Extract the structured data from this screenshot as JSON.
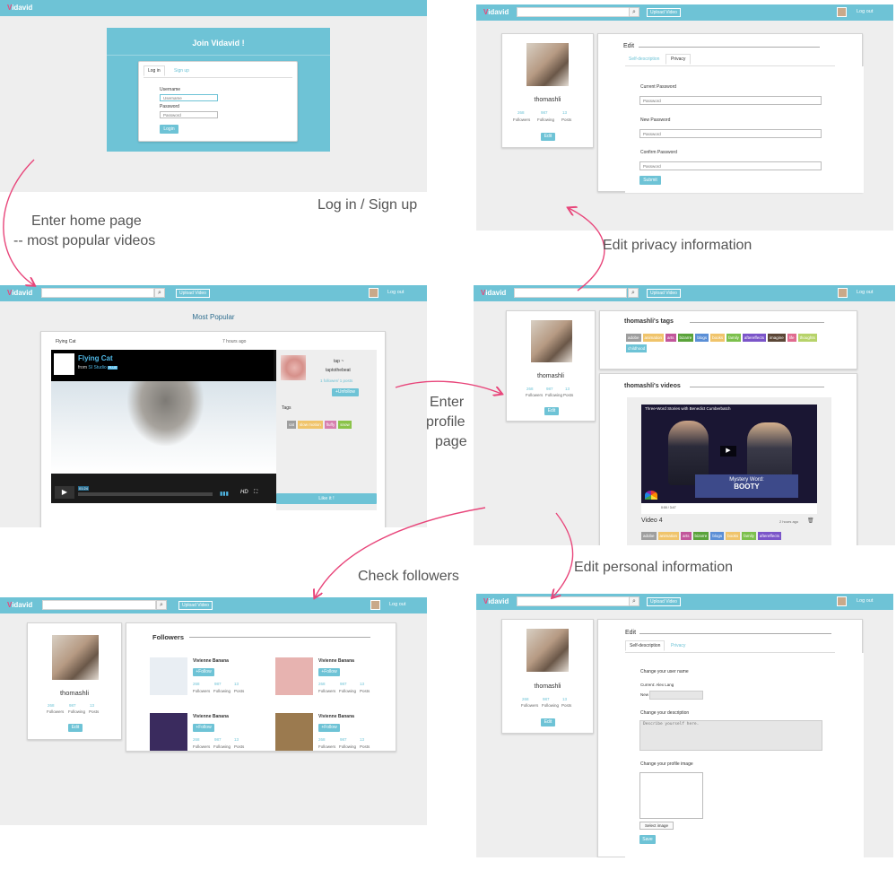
{
  "app": {
    "logo_v": "V",
    "logo_rest": "idavid",
    "upload": "Upload Video",
    "logout": "Log out",
    "search_icon": "search-icon"
  },
  "captions": {
    "login": "Log in / Sign up",
    "home_line1": "Enter home page",
    "home_line2": "-- most popular videos",
    "privacy": "Edit privacy information",
    "profile_line1": "Enter",
    "profile_line2": "profile",
    "profile_line3": "page",
    "followers": "Check followers",
    "personal": "Edit personal information"
  },
  "login": {
    "title": "Join Vidavid !",
    "tab_login": "Log in",
    "tab_signup": "Sign up",
    "username_label": "Username",
    "username_placeholder": "Username",
    "password_label": "Password",
    "password_placeholder": "Password",
    "login_button": "Login"
  },
  "profile": {
    "name": "thomashli",
    "followers_count": "268",
    "following_count": "987",
    "posts_count": "13",
    "followers_label": "Followers",
    "following_label": "Following",
    "posts_label": "Posts",
    "edit_button": "Edit"
  },
  "privacy": {
    "edit_title": "Edit",
    "tab_self": "Self-description",
    "tab_privacy": "Privacy",
    "current_label": "Current Password",
    "new_label": "New Password",
    "confirm_label": "Confirm Password",
    "placeholder": "Password",
    "submit": "Submit"
  },
  "home": {
    "section_title": "Most Popular",
    "video_title": "Flying Cat",
    "time_ago": "7 hours ago",
    "player_title": "Flying Cat",
    "player_from": "from",
    "player_studio": "SI Studio",
    "player_plus": "PLUS",
    "player_time": "01:24",
    "player_hd": "HD",
    "uploader_line1": "tap ~",
    "uploader_line2": "taptothebeat",
    "uploader_stats": "1 follower/ 1 posts",
    "follow_button": "+Unfollow",
    "tags_label": "Tags",
    "tags": [
      {
        "text": "cat",
        "color": "#9e9e9e"
      },
      {
        "text": "slow motion",
        "color": "#f0c46b"
      },
      {
        "text": "fluffy",
        "color": "#d77fae"
      },
      {
        "text": "snow",
        "color": "#8bc34a"
      }
    ],
    "like_button": "Like it !"
  },
  "profile_page": {
    "tags_title": "thomashli's tags",
    "tags": [
      {
        "text": "adobe",
        "color": "#9e9e9e"
      },
      {
        "text": "animation",
        "color": "#f0c46b"
      },
      {
        "text": "arts",
        "color": "#c2569b"
      },
      {
        "text": "bizarre",
        "color": "#5aa33a"
      },
      {
        "text": "blogs",
        "color": "#5b8fd6"
      },
      {
        "text": "books",
        "color": "#f0c46b"
      },
      {
        "text": "family",
        "color": "#7cc04c"
      },
      {
        "text": "aftereffects",
        "color": "#7b55c9"
      },
      {
        "text": "imagine",
        "color": "#5b4636"
      },
      {
        "text": "life",
        "color": "#e06b8f"
      },
      {
        "text": "thoughts",
        "color": "#b7d36a"
      },
      {
        "text": "childhood",
        "color": "#6ec3d6"
      }
    ],
    "videos_title": "thomashli's videos",
    "video_overlay_title": "Three-Word Stories with Benedict Cumberbatch",
    "video_sign1": "Mystery Word:",
    "video_sign2": "BOOTY",
    "video_time": "0:00 / 3:47",
    "video_name": "Video 4",
    "video_time_ago": "2 hours ago",
    "video_tags": [
      {
        "text": "adobe",
        "color": "#9e9e9e"
      },
      {
        "text": "animation",
        "color": "#f0c46b"
      },
      {
        "text": "arts",
        "color": "#c2569b"
      },
      {
        "text": "bizarre",
        "color": "#5aa33a"
      },
      {
        "text": "blogs",
        "color": "#5b8fd6"
      },
      {
        "text": "books",
        "color": "#f0c46b"
      },
      {
        "text": "family",
        "color": "#7cc04c"
      },
      {
        "text": "aftereffects",
        "color": "#7b55c9"
      }
    ]
  },
  "followers_page": {
    "title": "Followers",
    "items": [
      {
        "name": "Vivienne Banana",
        "button": "+Follow",
        "followers": "268",
        "following": "987",
        "posts": "13",
        "thumb_color": "#e9eef3"
      },
      {
        "name": "Vivienne Banana",
        "button": "+Follow",
        "followers": "268",
        "following": "987",
        "posts": "13",
        "thumb_color": "#e7b3b0"
      },
      {
        "name": "Vivienne Banana",
        "button": "+Follow",
        "followers": "268",
        "following": "987",
        "posts": "13",
        "thumb_color": "#3a2b5e"
      },
      {
        "name": "Vivienne Banana",
        "button": "+Follow",
        "followers": "268",
        "following": "987",
        "posts": "13",
        "thumb_color": "#9b7a4f"
      }
    ]
  },
  "personal": {
    "edit_title": "Edit",
    "tab_self": "Self-description",
    "tab_privacy": "Privacy",
    "username_heading": "Change your user name",
    "current_name": "Current: Alex Lang",
    "new_label": "New",
    "description_heading": "Change your description",
    "description_placeholder": "Describe yourself here.",
    "image_heading": "Change your profile image",
    "select_image": "Select image",
    "save": "Save"
  }
}
